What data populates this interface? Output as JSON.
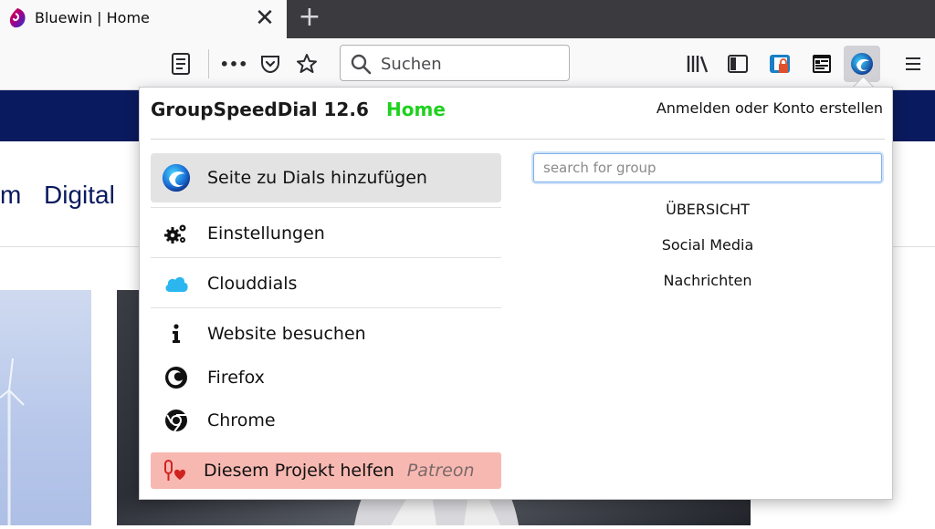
{
  "tabs": [
    {
      "title": "Bluewin | Home",
      "active": true,
      "favicon": "swisscom-logo-icon"
    }
  ],
  "tabstrip": {
    "close_symbol": "✕",
    "new_tab_symbol": "+"
  },
  "navbar": {
    "search_placeholder": "Suchen",
    "icons": [
      "reader-view-icon",
      "page-actions-icon",
      "pocket-icon",
      "bookmark-star-icon",
      "library-icon",
      "sidebar-icon",
      "extension-lock-icon",
      "extension-calendar-icon",
      "groupspeeddial-icon",
      "hamburger-menu-icon"
    ],
    "more_symbol": "•••"
  },
  "page": {
    "nav_items": [
      "m",
      "Digital"
    ],
    "band_color": "#0a1a5e"
  },
  "popup": {
    "title": "GroupSpeedDial 12.6",
    "home_link": "Home",
    "signin_link": "Anmelden oder Konto erstellen",
    "menu": [
      {
        "label": "Seite zu Dials hinzufügen",
        "icon": "groupspeeddial-logo-icon"
      },
      {
        "label": "Einstellungen",
        "icon": "gears-icon"
      },
      {
        "label": "Clouddials",
        "icon": "cloud-icon"
      },
      {
        "label": "Website besuchen",
        "icon": "info-icon"
      },
      {
        "label": "Firefox",
        "icon": "firefox-icon"
      },
      {
        "label": "Chrome",
        "icon": "chrome-icon"
      }
    ],
    "patreon": {
      "label": "Diesem Projekt helfen",
      "sub": "Patreon",
      "icon": "patreon-heart-icon"
    },
    "group_search_placeholder": "search for group",
    "groups": [
      "ÜBERSICHT",
      "Social Media",
      "Nachrichten"
    ],
    "colors": {
      "home": "#1fd11f",
      "patreon_bg": "#f8b8b2",
      "add_bg": "#e3e3e3"
    }
  }
}
